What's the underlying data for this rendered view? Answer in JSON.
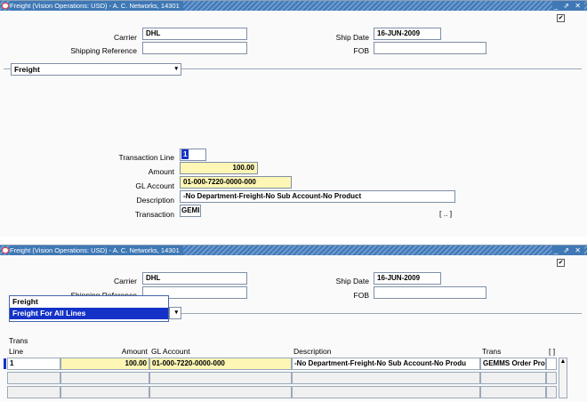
{
  "window1": {
    "title": "Freight (Vision Operations: USD) - A. C. Networks, 14301",
    "controls": "_ ⇗ ✕",
    "checkbox_mark": "✔",
    "carrier_label": "Carrier",
    "carrier_value": "DHL",
    "shipping_reference_label": "Shipping Reference",
    "shipping_reference_value": "",
    "ship_date_label": "Ship Date",
    "ship_date_value": "16-JUN-2009",
    "fob_label": "FOB",
    "fob_value": "",
    "poplist_value": "Freight",
    "transaction_line_label": "Transaction Line",
    "transaction_line_value": "1",
    "amount_label": "Amount",
    "amount_value": "100.00",
    "gl_account_label": "GL Account",
    "gl_account_value": "01-000-7220-0000-000",
    "description_label": "Description",
    "description_value": "-No Department-Freight-No Sub Account-No Product",
    "transaction_label": "Transaction",
    "transaction_value": "GEMI",
    "lov_button": "[ .. ]"
  },
  "window2": {
    "title": "Freight (Vision Operations: USD) - A. C. Networks, 14301",
    "controls": "_ ⇗ ✕",
    "checkbox_mark": "✔",
    "carrier_label": "Carrier",
    "carrier_value": "DHL",
    "shipping_reference_label": "Shipping Reference",
    "ship_date_label": "Ship Date",
    "ship_date_value": "16-JUN-2009",
    "fob_label": "FOB",
    "dropdown_options": [
      "Freight",
      "Freight For All Lines"
    ],
    "table": {
      "header_trans": "Trans",
      "header_line": "Line",
      "header_amount": "Amount",
      "header_gl_account": "GL Account",
      "header_description": "Description",
      "header_trans2": "Trans",
      "header_bracket": "[ ]",
      "row1": {
        "line": "1",
        "amount": "100.00",
        "gl_account": "01-000-7220-0000-000",
        "description": "-No Department-Freight-No Sub Account-No Produ",
        "trans": "GEMMS Order Pro"
      }
    }
  }
}
